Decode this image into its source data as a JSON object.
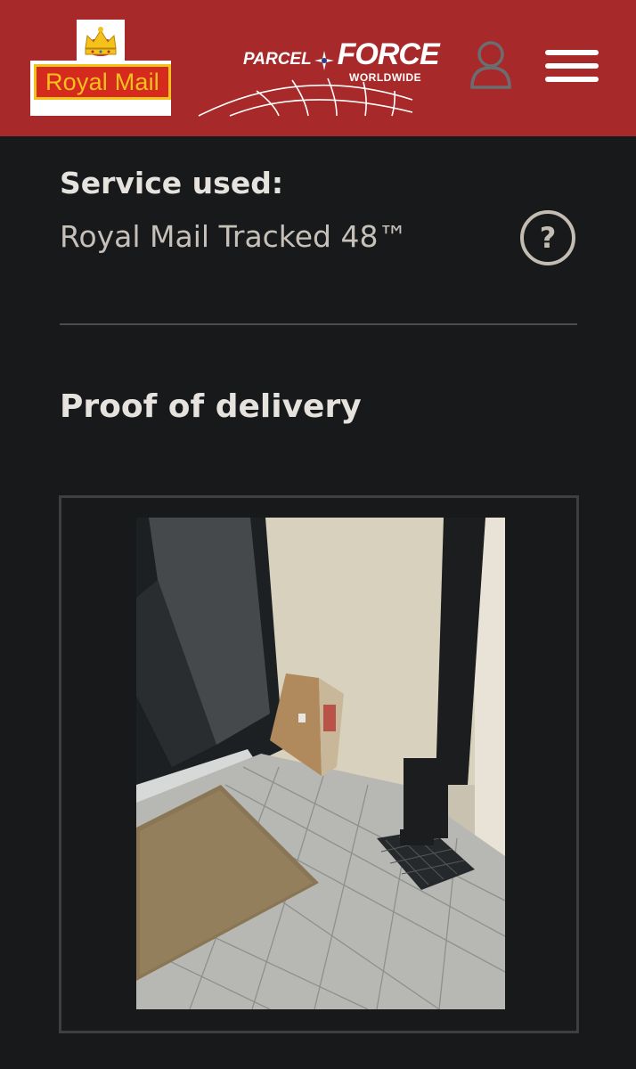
{
  "header": {
    "royal_mail_logo_text": "Royal Mail",
    "parcelforce_logo": {
      "parcel": "PARCEL",
      "force": "FORCE",
      "worldwide": "WORLDWIDE"
    },
    "background_color": "#a8292a",
    "account_icon": "user-icon",
    "menu_icon": "hamburger-menu-icon"
  },
  "service": {
    "label": "Service used:",
    "value": "Royal Mail Tracked 48™",
    "help_glyph": "?"
  },
  "proof": {
    "heading": "Proof of delivery"
  }
}
